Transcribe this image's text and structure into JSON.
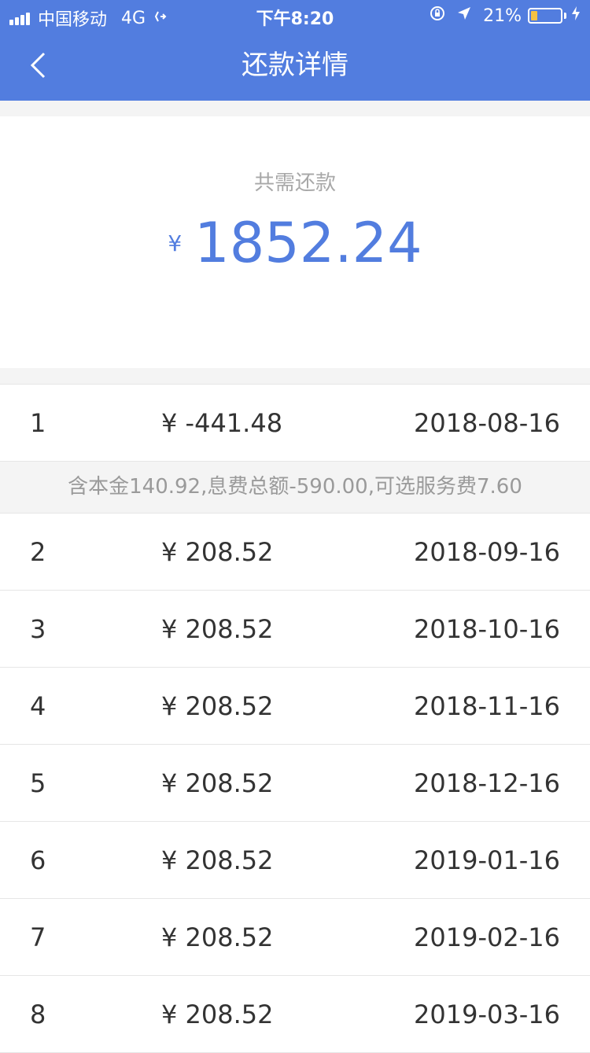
{
  "status_bar": {
    "carrier": "中国移动",
    "network": "4G",
    "time": "下午8:20",
    "battery_percent": "21%",
    "battery_level": 0.21
  },
  "nav": {
    "title": "还款详情"
  },
  "summary": {
    "label": "共需还款",
    "currency": "¥",
    "amount": "1852.24"
  },
  "installments": [
    {
      "index": "1",
      "amount": "¥ -441.48",
      "date": "2018-08-16"
    },
    {
      "index": "2",
      "amount": "¥ 208.52",
      "date": "2018-09-16"
    },
    {
      "index": "3",
      "amount": "¥ 208.52",
      "date": "2018-10-16"
    },
    {
      "index": "4",
      "amount": "¥ 208.52",
      "date": "2018-11-16"
    },
    {
      "index": "5",
      "amount": "¥ 208.52",
      "date": "2018-12-16"
    },
    {
      "index": "6",
      "amount": "¥ 208.52",
      "date": "2019-01-16"
    },
    {
      "index": "7",
      "amount": "¥ 208.52",
      "date": "2019-02-16"
    },
    {
      "index": "8",
      "amount": "¥ 208.52",
      "date": "2019-03-16"
    }
  ],
  "first_detail": "含本金140.92,息费总额-590.00,可选服务费7.60",
  "colors": {
    "header_bg": "#527ddf",
    "accent": "#527ddf",
    "battery": "#f5c242"
  }
}
